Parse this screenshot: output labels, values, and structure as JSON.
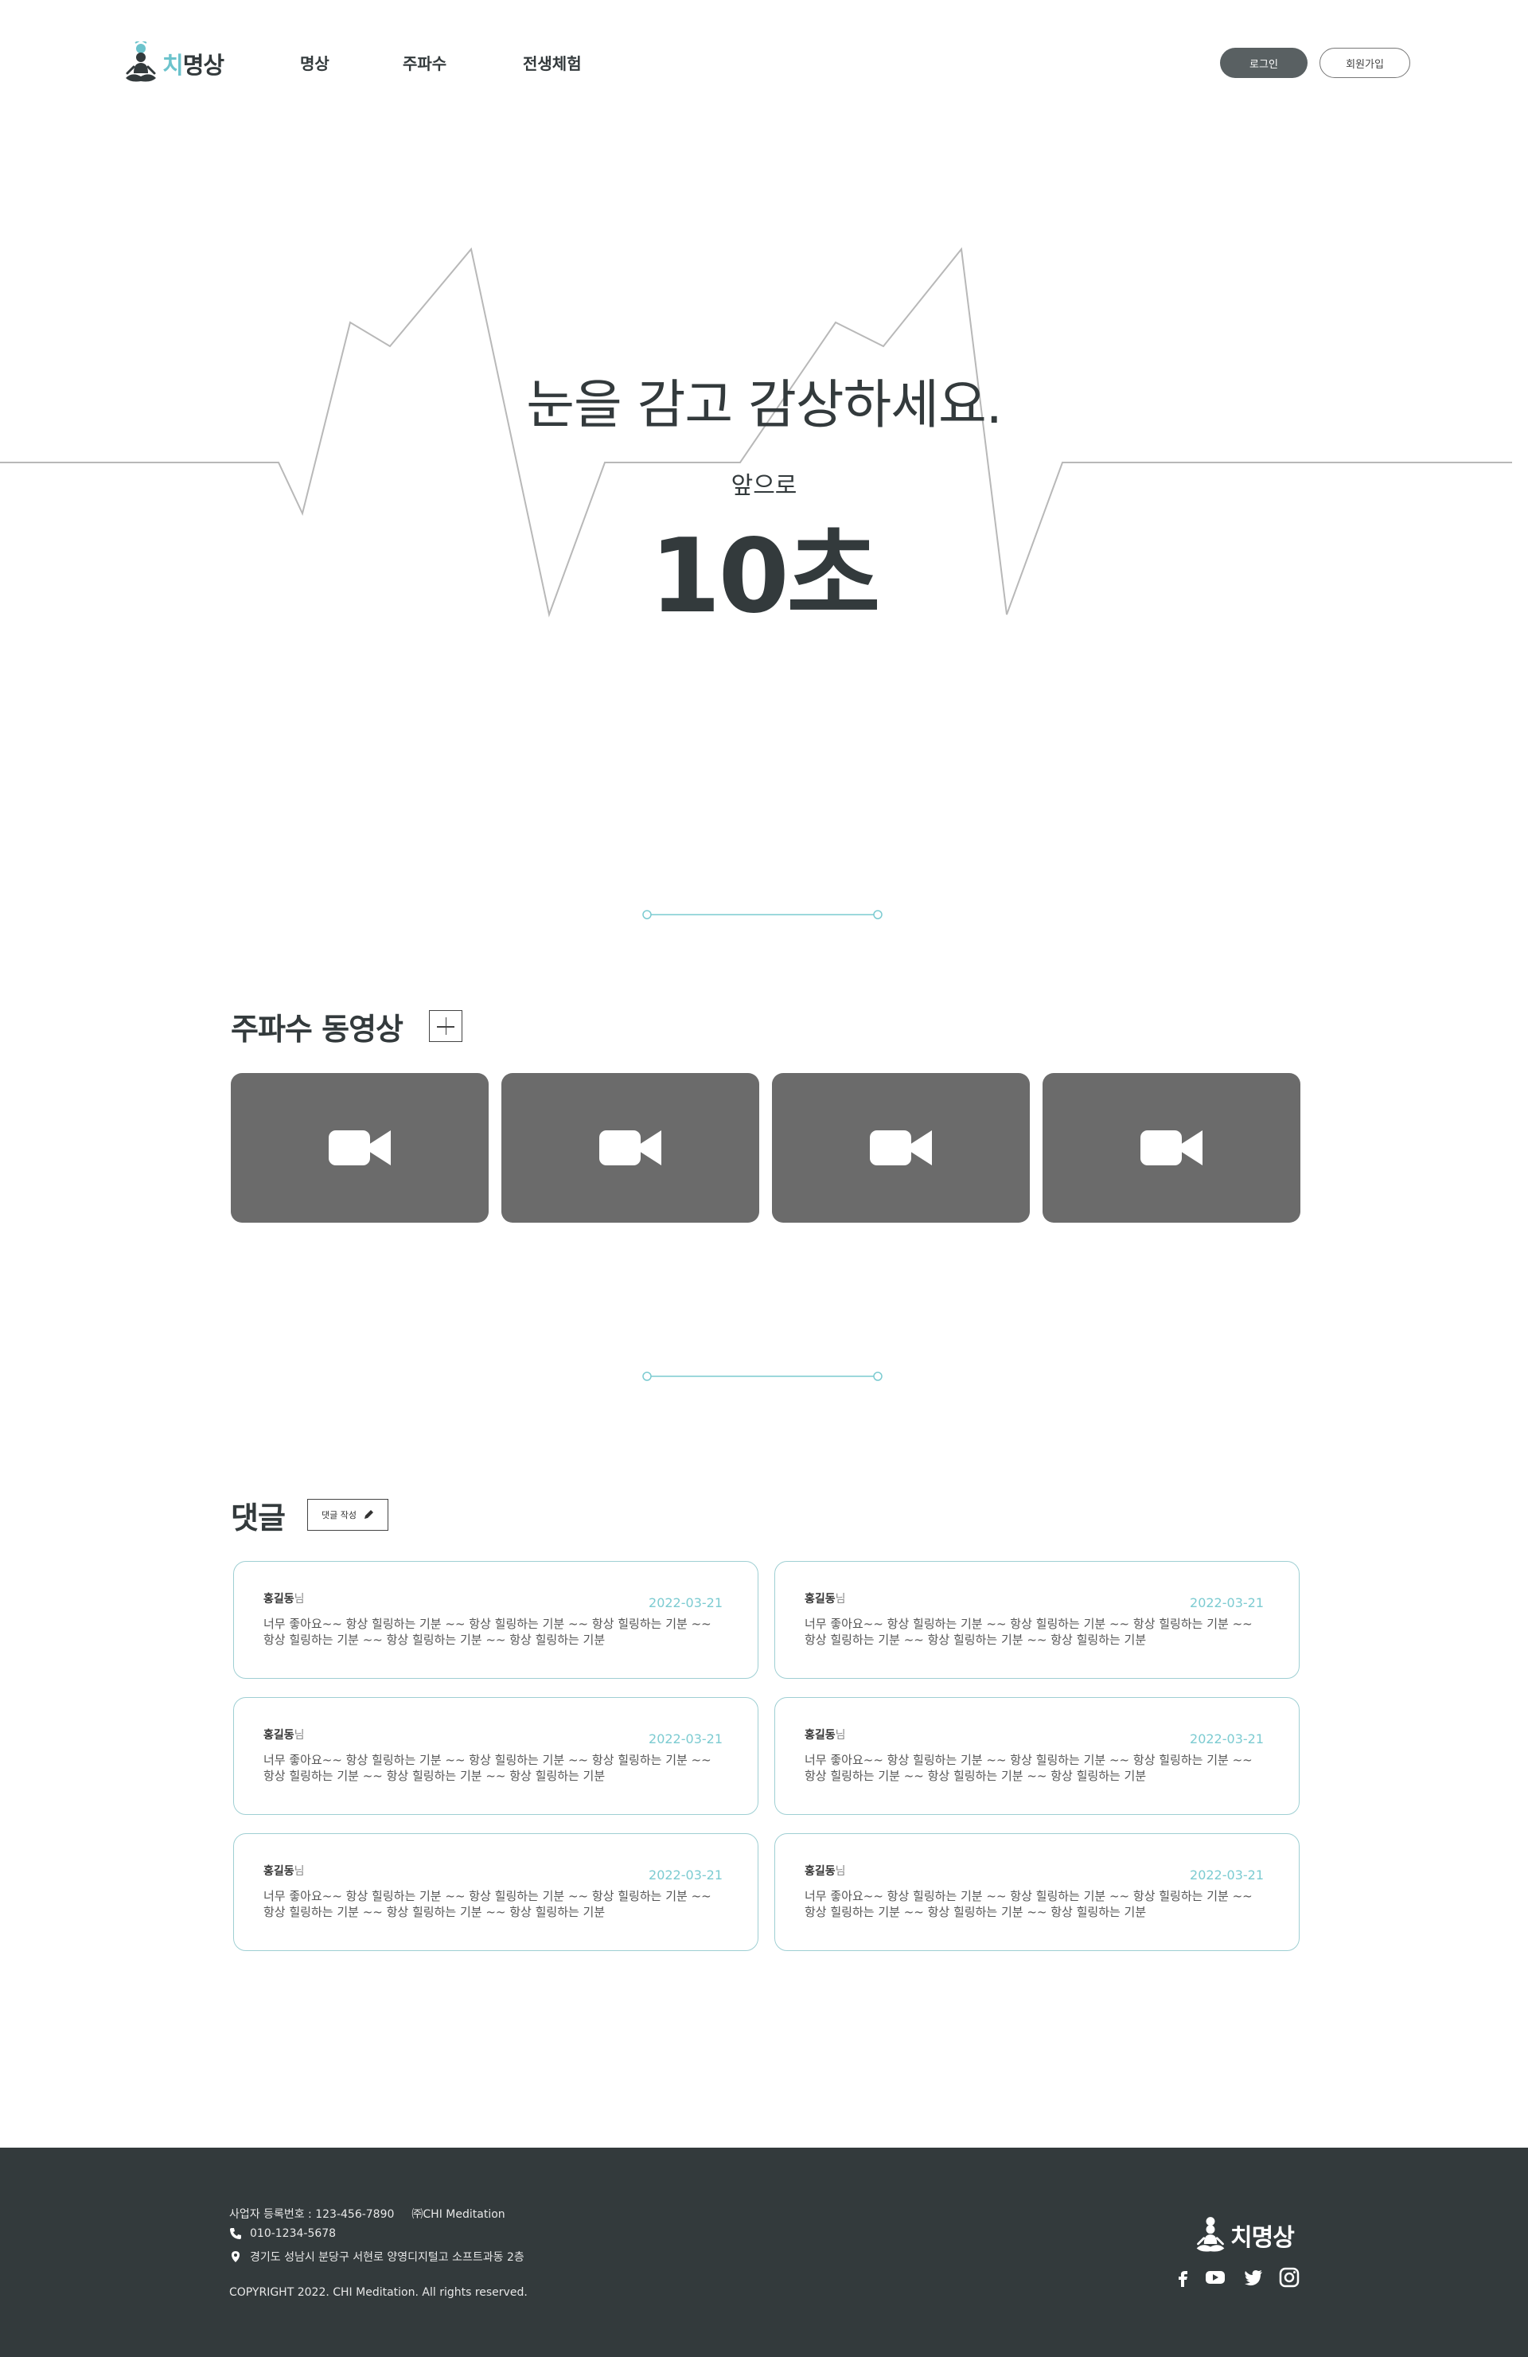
{
  "header": {
    "logo": {
      "accent": "치",
      "rest": "명상"
    },
    "nav": [
      {
        "label": "명상"
      },
      {
        "label": "주파수"
      },
      {
        "label": "전생체험"
      }
    ],
    "login_label": "로그인",
    "signup_label": "회원가입"
  },
  "hero": {
    "headline": "눈을 감고 감상하세요.",
    "sub": "앞으로",
    "countdown": "10초"
  },
  "videos": {
    "title": "주파수 동영상",
    "items": [
      {
        "icon": "video-camera-icon"
      },
      {
        "icon": "video-camera-icon"
      },
      {
        "icon": "video-camera-icon"
      },
      {
        "icon": "video-camera-icon"
      }
    ]
  },
  "comments": {
    "title": "댓글",
    "write_label": "댓글 작성",
    "items": [
      {
        "name": "홍길동",
        "suffix": "님",
        "date": "2022-03-21",
        "line1": "너무 좋아요~~ 항상 힐링하는 기분 ~~ 항상 힐링하는 기분 ~~ 항상 힐링하는 기분 ~~",
        "line2": "항상 힐링하는 기분 ~~ 항상 힐링하는 기분 ~~ 항상 힐링하는 기분"
      },
      {
        "name": "홍길동",
        "suffix": "님",
        "date": "2022-03-21",
        "line1": "너무 좋아요~~ 항상 힐링하는 기분 ~~ 항상 힐링하는 기분 ~~ 항상 힐링하는 기분 ~~",
        "line2": "항상 힐링하는 기분 ~~ 항상 힐링하는 기분 ~~ 항상 힐링하는 기분"
      },
      {
        "name": "홍길동",
        "suffix": "님",
        "date": "2022-03-21",
        "line1": "너무 좋아요~~ 항상 힐링하는 기분 ~~ 항상 힐링하는 기분 ~~ 항상 힐링하는 기분 ~~",
        "line2": "항상 힐링하는 기분 ~~ 항상 힐링하는 기분 ~~ 항상 힐링하는 기분"
      },
      {
        "name": "홍길동",
        "suffix": "님",
        "date": "2022-03-21",
        "line1": "너무 좋아요~~ 항상 힐링하는 기분 ~~ 항상 힐링하는 기분 ~~ 항상 힐링하는 기분 ~~",
        "line2": "항상 힐링하는 기분 ~~ 항상 힐링하는 기분 ~~ 항상 힐링하는 기분"
      },
      {
        "name": "홍길동",
        "suffix": "님",
        "date": "2022-03-21",
        "line1": "너무 좋아요~~ 항상 힐링하는 기분 ~~ 항상 힐링하는 기분 ~~ 항상 힐링하는 기분 ~~",
        "line2": "항상 힐링하는 기분 ~~ 항상 힐링하는 기분 ~~ 항상 힐링하는 기분"
      },
      {
        "name": "홍길동",
        "suffix": "님",
        "date": "2022-03-21",
        "line1": "너무 좋아요~~ 항상 힐링하는 기분 ~~ 항상 힐링하는 기분 ~~ 항상 힐링하는 기분 ~~",
        "line2": "항상 힐링하는 기분 ~~ 항상 힐링하는 기분 ~~ 항상 힐링하는 기분"
      }
    ]
  },
  "footer": {
    "business_number": "사업자 등록번호 : 123-456-7890",
    "company": "㈜CHI Meditation",
    "phone": "010-1234-5678",
    "address": "경기도 성남시 분당구 서현로 양영디지털고 소프트과동 2층",
    "copyright": "COPYRIGHT 2022. CHI Meditation. All rights reserved.",
    "logo": "치명상",
    "social": [
      "facebook-icon",
      "youtube-icon",
      "twitter-icon",
      "instagram-icon"
    ]
  },
  "colors": {
    "accent": "#6cc3cc",
    "dark": "#333a3c",
    "video_bg": "#6b6b6b",
    "comment_border": "#9fcfd3"
  }
}
